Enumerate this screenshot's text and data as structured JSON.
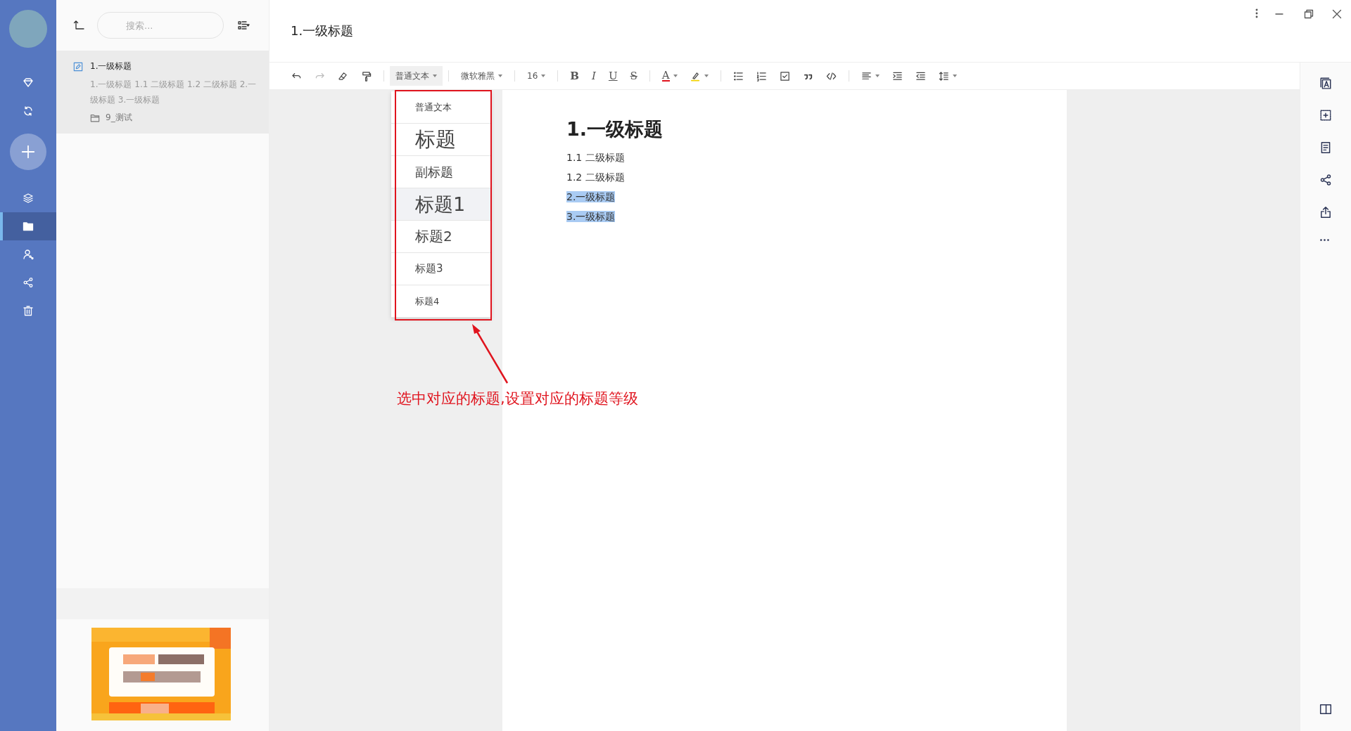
{
  "window": {
    "title": "1.一级标题"
  },
  "sidebar": {
    "items": [
      {
        "kind": "favorites",
        "selected": false
      },
      {
        "kind": "sync",
        "selected": false
      },
      {
        "kind": "add",
        "selected": false
      },
      {
        "kind": "layers",
        "selected": false
      },
      {
        "kind": "folder",
        "selected": true
      },
      {
        "kind": "people",
        "selected": false
      },
      {
        "kind": "share",
        "selected": false
      },
      {
        "kind": "trash",
        "selected": false
      }
    ]
  },
  "note_list": {
    "search": {
      "placeholder": "搜索..."
    },
    "notes": [
      {
        "title": "1.一级标题",
        "snippet": "1.一级标题 1.1 二级标题 1.2 二级标题 2.一级标题 3.一级标题",
        "folder": "9_测试",
        "selected": true
      }
    ]
  },
  "toolbar": {
    "style": "普通文本",
    "font": "微软雅黑",
    "size": "16",
    "format_buttons": [
      "B",
      "I",
      "U",
      "S"
    ],
    "color_button": "A"
  },
  "style_menu": {
    "items": [
      {
        "label": "普通文本",
        "kind": "normal",
        "selected": false
      },
      {
        "label": "标题",
        "kind": "title",
        "selected": false
      },
      {
        "label": "副标题",
        "kind": "subtitle",
        "selected": false
      },
      {
        "label": "标题1",
        "kind": "h1",
        "selected": true
      },
      {
        "label": "标题2",
        "kind": "h2",
        "selected": false
      },
      {
        "label": "标题3",
        "kind": "h3",
        "selected": false
      },
      {
        "label": "标题4",
        "kind": "h4",
        "selected": false
      }
    ]
  },
  "document": {
    "heading": "1.一级标题",
    "paragraphs": [
      {
        "text": "1.1 二级标题",
        "selected": false
      },
      {
        "text": "1.2 二级标题",
        "selected": false
      },
      {
        "text": "2.一级标题",
        "selected": true
      },
      {
        "text": "3.一级标题",
        "selected": true
      }
    ]
  },
  "annotation": {
    "text": "选中对应的标题,设置对应的标题等级"
  }
}
